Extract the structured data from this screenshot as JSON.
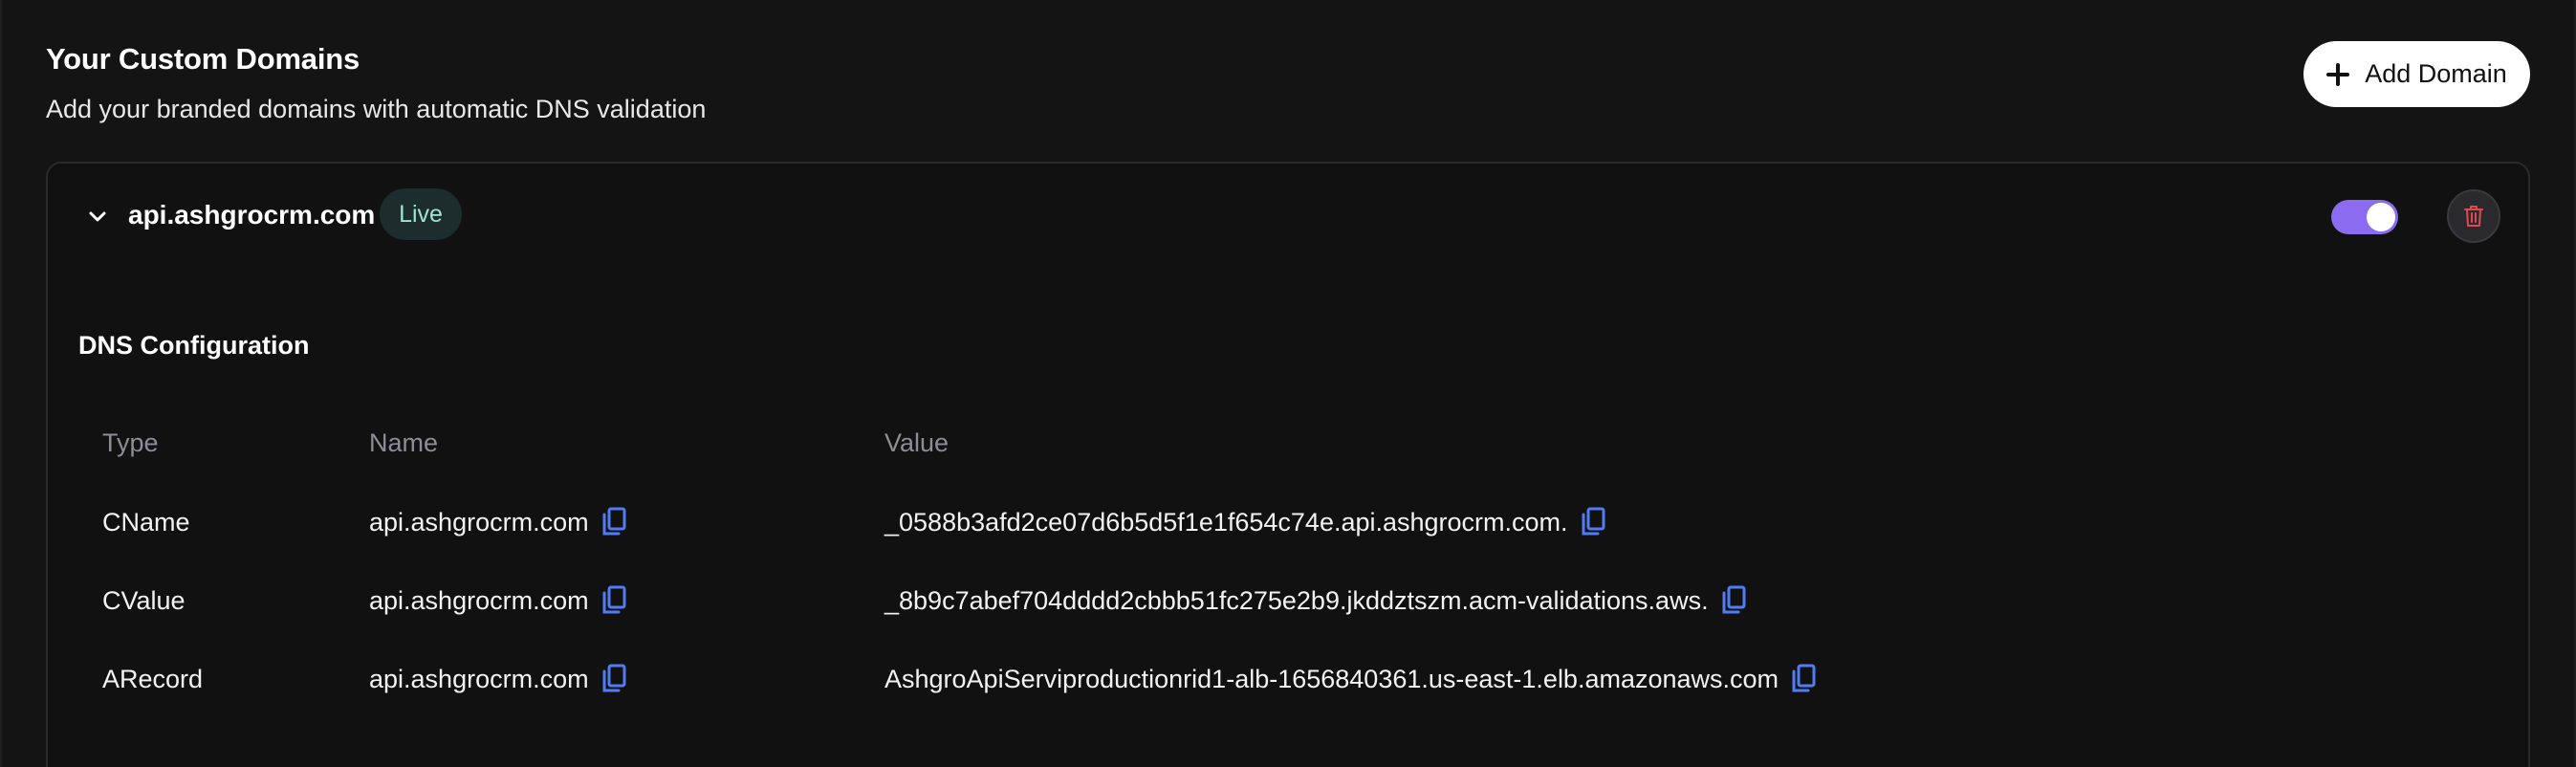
{
  "header": {
    "title": "Your Custom Domains",
    "subtitle": "Add your branded domains with automatic DNS validation",
    "add_button_label": "Add Domain"
  },
  "domain": {
    "name": "api.ashgrocrm.com",
    "status": "Live",
    "enabled": true
  },
  "dns": {
    "title": "DNS Configuration",
    "columns": [
      "Type",
      "Name",
      "Value"
    ],
    "rows": [
      {
        "type": "CName",
        "name": "api.ashgrocrm.com",
        "value": "_0588b3afd2ce07d6b5d5f1e1f654c74e.api.ashgrocrm.com."
      },
      {
        "type": "CValue",
        "name": "api.ashgrocrm.com",
        "value": "_8b9c7abef704dddd2cbbb51fc275e2b9.jkddztszm.acm-validations.aws."
      },
      {
        "type": "ARecord",
        "name": "api.ashgrocrm.com",
        "value": "AshgroApiServiproductionrid1-alb-1656840361.us-east-1.elb.amazonaws.com"
      }
    ]
  },
  "colors": {
    "background": "#121212",
    "accent_toggle": "#8b6cf0",
    "badge_bg": "#1d2c2c",
    "badge_text": "#9fe3d2",
    "copy_icon": "#4f7df5",
    "delete_icon": "#e0494f"
  },
  "icons": {
    "add": "plus-icon",
    "expand": "chevron-down-icon",
    "copy": "copy-icon",
    "delete": "trash-icon"
  }
}
